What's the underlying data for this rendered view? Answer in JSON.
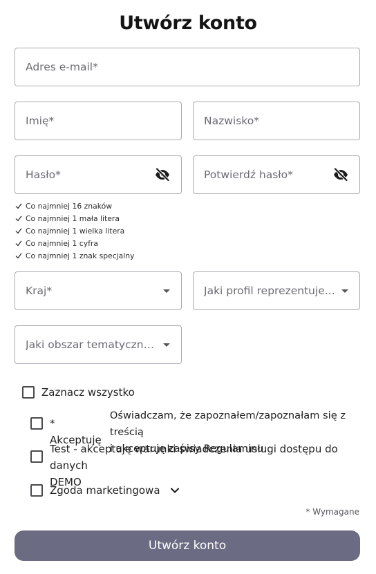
{
  "title": "Utwórz konto",
  "fields": {
    "email": {
      "placeholder": "Adres e-mail*",
      "value": ""
    },
    "first_name": {
      "placeholder": "Imię*",
      "value": ""
    },
    "last_name": {
      "placeholder": "Nazwisko*",
      "value": ""
    },
    "password": {
      "placeholder": "Hasło*",
      "value": "",
      "icon": "eye-slash-icon"
    },
    "confirm_password": {
      "placeholder": "Potwierdź hasło*",
      "value": "",
      "icon": "eye-slash-icon"
    },
    "country": {
      "placeholder": "Kraj*",
      "value": ""
    },
    "profile": {
      "placeholder": "Jaki profil reprezentuje...",
      "value": ""
    },
    "topic_area": {
      "placeholder": "Jaki obszar tematyczny ...",
      "value": ""
    }
  },
  "password_rules": [
    "Co najmniej 16 znaków",
    "Co najmniej 1 mała litera",
    "Co najmniej 1 wielka litera",
    "Co najmniej 1 cyfra",
    "Co najmniej 1 znak specjalny"
  ],
  "consents": {
    "select_all": "Zaznacz wszystko",
    "terms_prefix": "* Akceptuję",
    "terms_line1": "Oświadczam, że zapoznałem/zapoznałam się z treścią",
    "terms_line2_a": "i akceptuję zapisy ",
    "terms_link": "Regulaminu",
    "terms_line2_b": ".",
    "service_line1": "Test - akceptuję warunki świadczenia usługi dostępu do danych",
    "service_line2": "DEMO",
    "marketing": "Zgoda marketingowa"
  },
  "required_note": "* Wymagane",
  "submit_label": "Utwórz konto",
  "colors": {
    "submit_bg": "#6b6b83",
    "border": "#a9a9b0",
    "placeholder": "#6b6b73"
  }
}
